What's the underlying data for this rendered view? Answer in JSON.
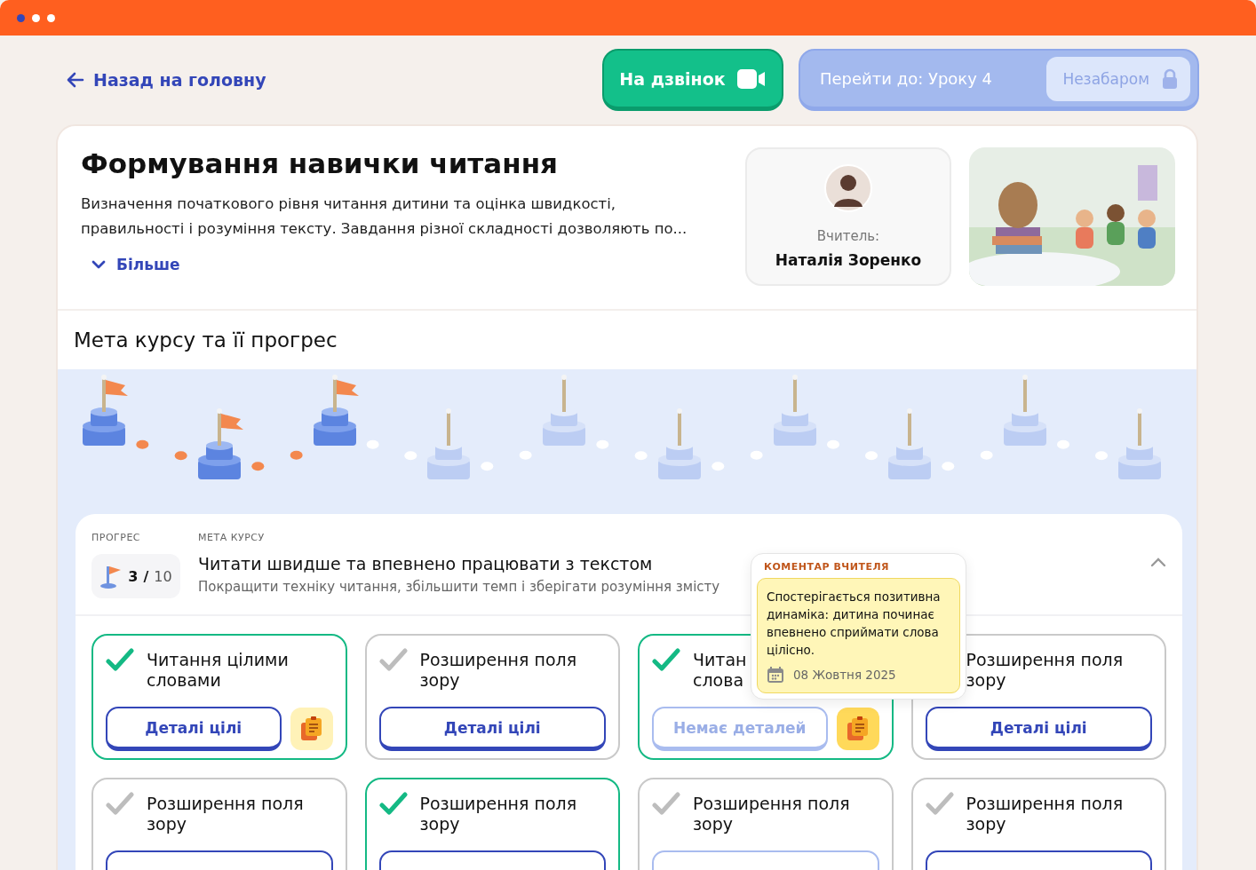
{
  "back_link": "Назад на головну",
  "call_button": "На дзвінок",
  "next_lesson": {
    "label": "Перейти до: Уроку 4",
    "badge": "Незабаром",
    "disabled": true
  },
  "course": {
    "title": "Формування навички читання",
    "description": "Визначення початкового рівня читання дитини та оцінка швидкості, правильності і розуміння тексту. Завдання різної складності дозволяють по...",
    "more": "Більше"
  },
  "teacher": {
    "label": "Вчитель:",
    "name": "Наталія Зоренко"
  },
  "progress_section": {
    "title": "Мета курсу та її прогрес"
  },
  "milestones": [
    {
      "done": true
    },
    {
      "done": true
    },
    {
      "done": true
    },
    {
      "done": false
    },
    {
      "done": false
    },
    {
      "done": false
    },
    {
      "done": false
    },
    {
      "done": false
    },
    {
      "done": false
    },
    {
      "done": false
    }
  ],
  "goal": {
    "progress_label": "ПРОГРЕС",
    "goal_label": "МЕТА КУРСУ",
    "count": "3",
    "separator": "/",
    "total": "10",
    "title": "Читати швидше та впевнено працювати з текстом",
    "subtitle": "Покращити техніку читання, збільшити темп і зберігати розуміння змісту",
    "expanded": true
  },
  "comment": {
    "title": "КОМЕНТАР ВЧИТЕЛЯ",
    "text": "Спостерігається позитивна динаміка: дитина починає впевнено сприймати слова цілісно.",
    "date": "08 Жовтня 2025"
  },
  "cards": [
    {
      "lines": [
        "Читання цілими",
        "словами"
      ],
      "done": true,
      "button": "Деталі цілі",
      "has_details": true,
      "note": true,
      "note_active": false
    },
    {
      "lines": [
        "Розширення поля",
        "зору"
      ],
      "done": false,
      "button": "Деталі цілі",
      "has_details": true,
      "note": false
    },
    {
      "lines": [
        "Читан",
        "слова"
      ],
      "done": true,
      "button": "Немає деталей",
      "has_details": false,
      "note": true,
      "note_active": true
    },
    {
      "lines": [
        "Розширення поля",
        "зору"
      ],
      "done": false,
      "covered": true,
      "button": "Деталі цілі",
      "has_details": true,
      "note": false
    },
    {
      "lines": [
        "Розширення поля",
        "зору"
      ],
      "done": false,
      "has_details": true,
      "note": false
    },
    {
      "lines": [
        "Розширення поля",
        "зору"
      ],
      "done": true,
      "has_details": true,
      "note": false
    },
    {
      "lines": [
        "Розширення поля",
        "зору"
      ],
      "done": false,
      "has_details": false,
      "note": false
    },
    {
      "lines": [
        "Розширення поля",
        "зору"
      ],
      "done": false,
      "has_details": true,
      "note": false
    }
  ]
}
